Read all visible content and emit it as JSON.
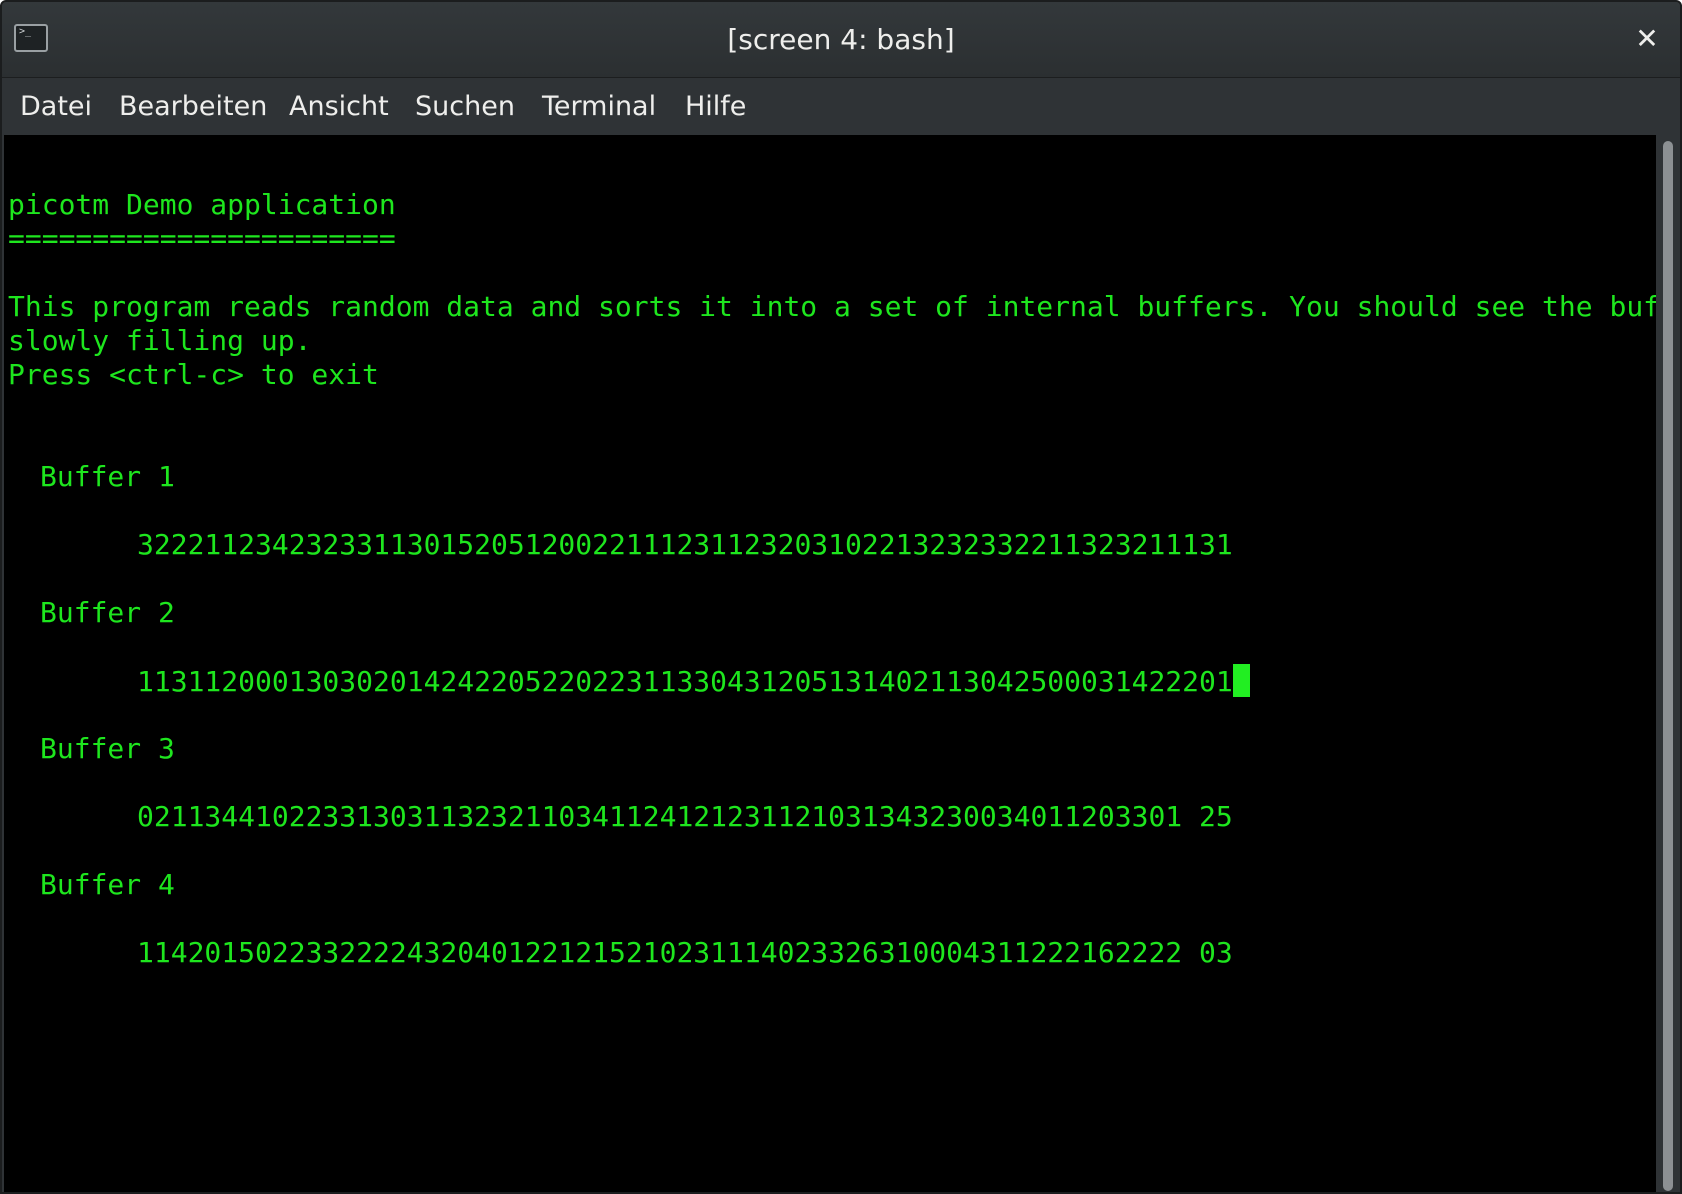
{
  "window": {
    "title": "[screen 4: bash]",
    "icon": "terminal-icon",
    "close_icon": "close-icon",
    "close_glyph": "✕"
  },
  "menu": {
    "items": [
      "Datei",
      "Bearbeiten",
      "Ansicht",
      "Suchen",
      "Terminal",
      "Hilfe"
    ]
  },
  "terminal": {
    "heading": "picotm Demo application",
    "underline": "=======================",
    "intro_line1": "This program reads random data and sorts it into a set of internal buffers. You should see the buffers",
    "intro_line2": "slowly filling up.",
    "exit_hint": "Press <ctrl-c> to exit",
    "buffers": [
      {
        "label": "Buffer 1",
        "content": "32221123423233113015205120022111231123203102213232332211323211131"
      },
      {
        "label": "Buffer 2",
        "content": "11311200013030201424220522022311330431205131402113042500031422201"
      },
      {
        "label": "Buffer 3",
        "content": "02113441022331303113232110341124121231121031343230034011203301 25"
      },
      {
        "label": "Buffer 4",
        "content": "11420150223322224320401221215210231114023326310004311222162222 03"
      }
    ],
    "text_color": "#1ee61e",
    "background_color": "#000000"
  }
}
